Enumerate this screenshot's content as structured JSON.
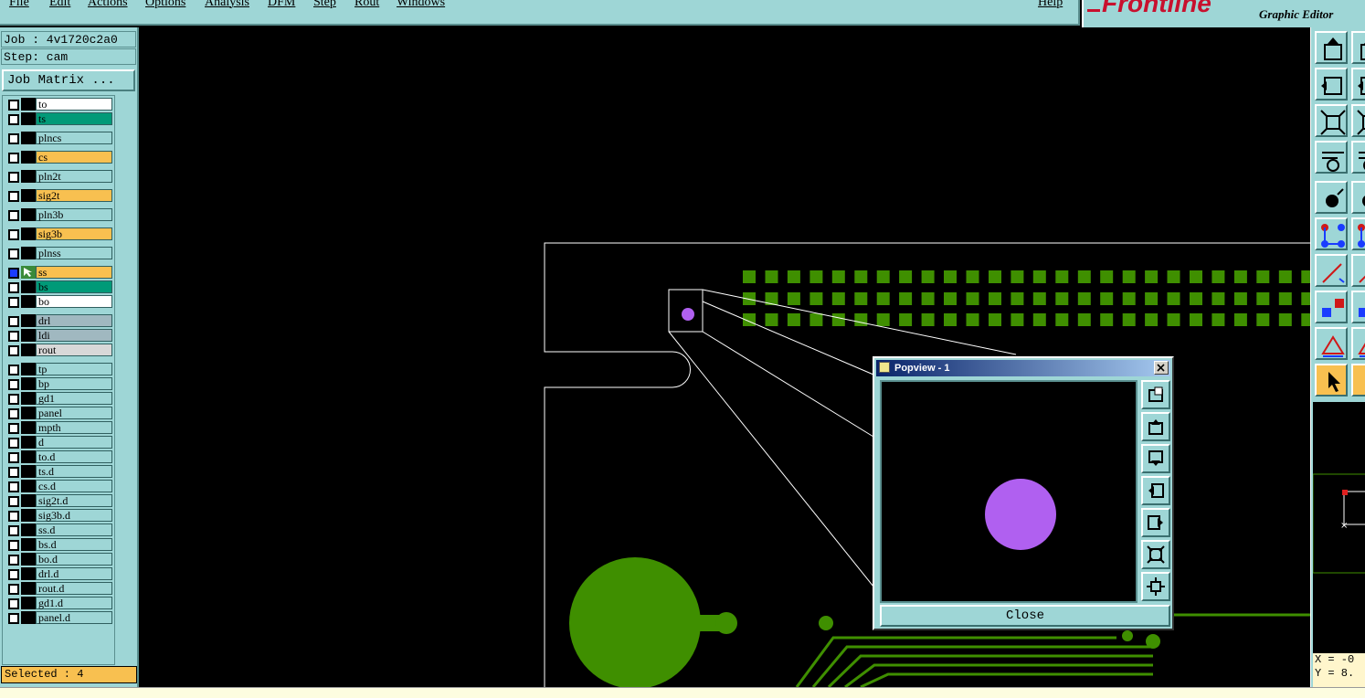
{
  "menu": [
    "File",
    "Edit",
    "Actions",
    "Options",
    "Analysis",
    "DFM",
    "Step",
    "Rout",
    "Windows"
  ],
  "help": "Help",
  "brand": {
    "logo": "Frontline",
    "subtitle": "Graphic Editor"
  },
  "job": "Job : 4v1720c2a0",
  "step": "Step: cam",
  "job_matrix_button": "Job Matrix ...",
  "layers": [
    {
      "name": "to",
      "color": "#ffffff"
    },
    {
      "name": "ts",
      "color": "#009a78"
    },
    {
      "name": "plncs",
      "color": "#9ed6d6"
    },
    {
      "name": "cs",
      "color": "#f8c050"
    },
    {
      "name": "pln2t",
      "color": "#9ed6d6"
    },
    {
      "name": "sig2t",
      "color": "#f8c050"
    },
    {
      "name": "pln3b",
      "color": "#9ed6d6"
    },
    {
      "name": "sig3b",
      "color": "#f8c050"
    },
    {
      "name": "plnss",
      "color": "#9ed6d6"
    },
    {
      "name": "ss",
      "color": "#f8c050",
      "active": true
    },
    {
      "name": "bs",
      "color": "#009a78"
    },
    {
      "name": "bo",
      "color": "#ffffff"
    },
    {
      "name": "drl",
      "color": "#a0b8c0"
    },
    {
      "name": "ldi",
      "color": "#a0b8c0"
    },
    {
      "name": "rout",
      "color": "#d8d8d8"
    },
    {
      "name": "tp",
      "color": "#9ed6d6"
    },
    {
      "name": "bp",
      "color": "#9ed6d6"
    },
    {
      "name": "gd1",
      "color": "#9ed6d6"
    },
    {
      "name": "panel",
      "color": "#9ed6d6"
    },
    {
      "name": "mpth",
      "color": "#9ed6d6"
    },
    {
      "name": "d",
      "color": "#9ed6d6"
    },
    {
      "name": "to.d",
      "color": "#9ed6d6"
    },
    {
      "name": "ts.d",
      "color": "#9ed6d6"
    },
    {
      "name": "cs.d",
      "color": "#9ed6d6"
    },
    {
      "name": "sig2t.d",
      "color": "#9ed6d6"
    },
    {
      "name": "sig3b.d",
      "color": "#9ed6d6"
    },
    {
      "name": "ss.d",
      "color": "#9ed6d6"
    },
    {
      "name": "bs.d",
      "color": "#9ed6d6"
    },
    {
      "name": "bo.d",
      "color": "#9ed6d6"
    },
    {
      "name": "drl.d",
      "color": "#9ed6d6"
    },
    {
      "name": "rout.d",
      "color": "#9ed6d6"
    },
    {
      "name": "gd1.d",
      "color": "#9ed6d6"
    },
    {
      "name": "panel.d",
      "color": "#9ed6d6"
    }
  ],
  "selected": "Selected : 4",
  "popview": {
    "title": "Popview - 1",
    "close": "Close"
  },
  "coords": {
    "x": "X = -0",
    "y": "Y = 8."
  },
  "colors": {
    "panel_bg": "#9ed6d6",
    "pad_green": "#3f8f00",
    "feature_purple": "#b060f0"
  }
}
